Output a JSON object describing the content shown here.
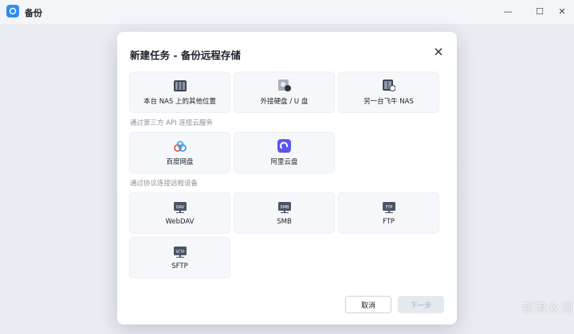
{
  "app": {
    "title": "备份",
    "icon": "backup-app-icon"
  },
  "window_controls": {
    "minimize": "—",
    "maximize": "☐",
    "close": "✕"
  },
  "dialog": {
    "title": "新建任务 - 备份远程存储",
    "sections": [
      {
        "label": "",
        "items": [
          {
            "label": "本台 NAS 上的其他位置",
            "icon": "nas-server-icon"
          },
          {
            "label": "外接硬盘 / U 盘",
            "icon": "external-drive-icon"
          },
          {
            "label": "另一台飞牛 NAS",
            "icon": "other-nas-icon"
          }
        ]
      },
      {
        "label": "通过第三方 API 连接云服务",
        "items": [
          {
            "label": "百度网盘",
            "icon": "baidu-netdisk-icon"
          },
          {
            "label": "阿里云盘",
            "icon": "aliyun-drive-icon"
          }
        ]
      },
      {
        "label": "通过协议连接远程设备",
        "items": [
          {
            "label": "WebDAV",
            "icon": "webdav-drive-icon",
            "tag": "DAV"
          },
          {
            "label": "SMB",
            "icon": "smb-drive-icon",
            "tag": "SMB"
          },
          {
            "label": "FTP",
            "icon": "ftp-drive-icon",
            "tag": "FTP"
          },
          {
            "label": "SFTP",
            "icon": "sftp-drive-icon",
            "tag": "SFTP"
          }
        ]
      }
    ],
    "cancel_label": "取消",
    "next_label": "下一步"
  },
  "watermark": "新浪众测",
  "colors": {
    "accent": "#2f8cf4",
    "card_bg": "#f5f7fa",
    "disabled": "#e4e9f0"
  }
}
